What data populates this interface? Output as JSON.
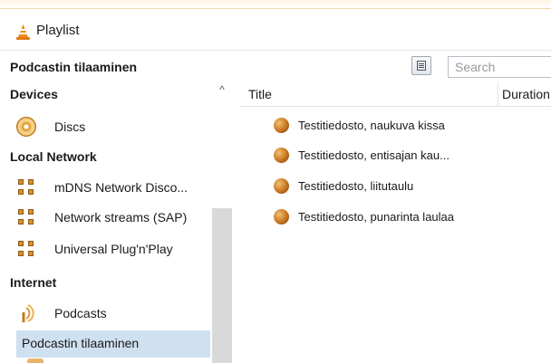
{
  "window": {
    "title": "Playlist",
    "icon": "vlc-cone-icon"
  },
  "header": {
    "breadcrumb": "Podcastin tilaaminen",
    "view_icon": "view-mode-icon",
    "search": {
      "placeholder": "Search",
      "value": ""
    }
  },
  "sidebar": {
    "scroll_up": "^",
    "sections": [
      {
        "label": "Devices",
        "items": [
          {
            "label": "Discs",
            "icon": "disc-icon"
          }
        ]
      },
      {
        "label": "Local Network",
        "items": [
          {
            "label": "mDNS Network Disco...",
            "icon": "network-icon"
          },
          {
            "label": "Network streams (SAP)",
            "icon": "network-icon"
          },
          {
            "label": "Universal Plug'n'Play",
            "icon": "network-icon"
          }
        ]
      },
      {
        "label": "Internet",
        "items": [
          {
            "label": "Podcasts",
            "icon": "podcast-icon"
          },
          {
            "label": "Podcastin tilaaminen",
            "icon": "",
            "selected": true
          }
        ]
      }
    ]
  },
  "playlist": {
    "columns": [
      "Title",
      "Duration"
    ],
    "rows": [
      {
        "title": "Testitiedosto, naukuva kissa",
        "icon": "media-file-icon"
      },
      {
        "title": "Testitiedosto, entisajan kau...",
        "icon": "media-file-icon"
      },
      {
        "title": "Testitiedosto, liitutaulu",
        "icon": "media-file-icon"
      },
      {
        "title": "Testitiedosto, punarinta laulaa",
        "icon": "media-file-icon"
      }
    ]
  },
  "colors": {
    "accent": "#d98f2a",
    "selection": "#cfe0f1",
    "scroll_track": "#d9d9d9"
  }
}
